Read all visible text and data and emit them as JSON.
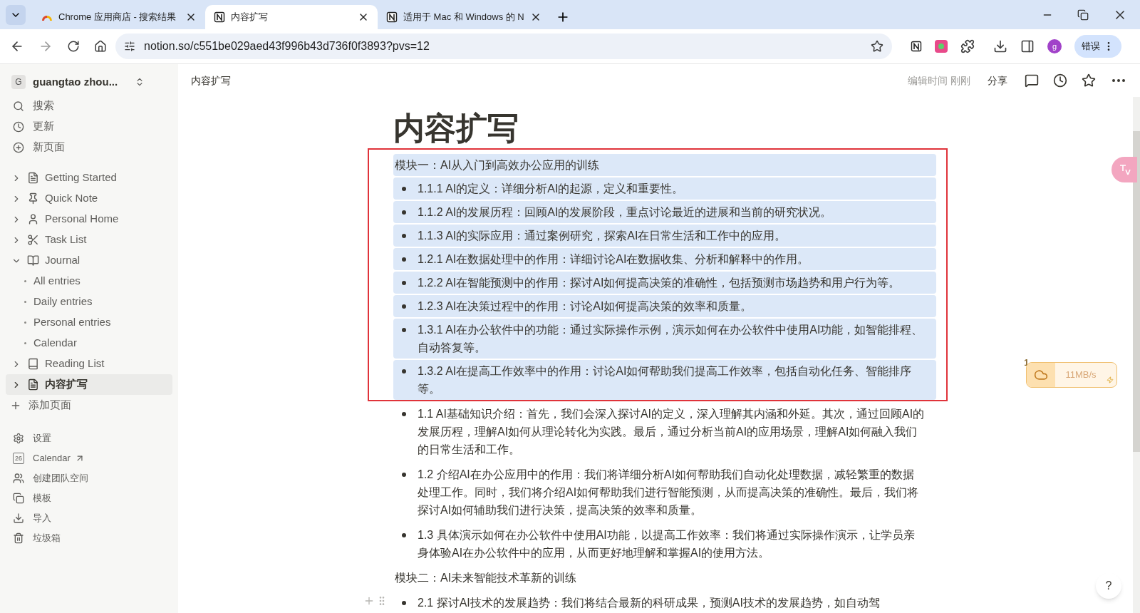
{
  "browser": {
    "tabs": [
      {
        "title": "Chrome 应用商店 - 搜索结果",
        "selected": false
      },
      {
        "title": "内容扩写",
        "selected": true
      },
      {
        "title": "适用于 Mac 和 Windows 的 N",
        "selected": false
      }
    ],
    "url": "notion.so/c551be029aed43f996b43d736f0f3893?pvs=12",
    "profile": "g",
    "error_button": "错误"
  },
  "sidebar": {
    "workspace_initial": "G",
    "workspace": "guangtao zhou...",
    "top_items": [
      {
        "label": "搜索"
      },
      {
        "label": "更新"
      },
      {
        "label": "新页面"
      }
    ],
    "pages": [
      {
        "label": "Getting Started",
        "expanded": false,
        "selected": false
      },
      {
        "label": "Quick Note",
        "expanded": false,
        "selected": false
      },
      {
        "label": "Personal Home",
        "expanded": false,
        "selected": false
      },
      {
        "label": "Task List",
        "expanded": false,
        "selected": false
      },
      {
        "label": "Journal",
        "expanded": true,
        "selected": false,
        "children": [
          {
            "label": "All entries"
          },
          {
            "label": "Daily entries"
          },
          {
            "label": "Personal entries"
          },
          {
            "label": "Calendar"
          }
        ]
      },
      {
        "label": "Reading List",
        "expanded": false,
        "selected": false
      },
      {
        "label": "内容扩写",
        "expanded": false,
        "selected": true
      }
    ],
    "add_page": "添加页面",
    "bottom_items": [
      {
        "label": "设置"
      },
      {
        "label": "Calendar",
        "calendar_day": "26"
      },
      {
        "label": "创建团队空间"
      },
      {
        "label": "模板"
      },
      {
        "label": "导入"
      },
      {
        "label": "垃圾箱"
      }
    ]
  },
  "topbar": {
    "breadcrumb": "内容扩写",
    "edited": "编辑时间 刚刚",
    "share": "分享"
  },
  "page": {
    "title": "内容扩写",
    "blocks": [
      {
        "kind": "text",
        "selected": true,
        "text": "模块一：AI从入门到高效办公应用的训练"
      },
      {
        "kind": "bullet",
        "selected": true,
        "text": "1.1.1 AI的定义：详细分析AI的起源，定义和重要性。"
      },
      {
        "kind": "bullet",
        "selected": true,
        "text": "1.1.2 AI的发展历程：回顾AI的发展阶段，重点讨论最近的进展和当前的研究状况。"
      },
      {
        "kind": "bullet",
        "selected": true,
        "text": "1.1.3 AI的实际应用：通过案例研究，探索AI在日常生活和工作中的应用。"
      },
      {
        "kind": "bullet",
        "selected": true,
        "text": "1.2.1 AI在数据处理中的作用：详细讨论AI在数据收集、分析和解释中的作用。"
      },
      {
        "kind": "bullet",
        "selected": true,
        "text": "1.2.2 AI在智能预测中的作用：探讨AI如何提高决策的准确性，包括预测市场趋势和用户行为等。"
      },
      {
        "kind": "bullet",
        "selected": true,
        "text": "1.2.3 AI在决策过程中的作用：讨论AI如何提高决策的效率和质量。"
      },
      {
        "kind": "bullet",
        "selected": true,
        "text": "1.3.1 AI在办公软件中的功能：通过实际操作示例，演示如何在办公软件中使用AI功能，如智能排程、自动答复等。"
      },
      {
        "kind": "bullet",
        "selected": true,
        "text": "1.3.2 AI在提高工作效率中的作用：讨论AI如何帮助我们提高工作效率，包括自动化任务、智能排序等。"
      },
      {
        "kind": "bullet",
        "selected": false,
        "text": "1.1 AI基础知识介绍：首先，我们会深入探讨AI的定义，深入理解其内涵和外延。其次，通过回顾AI的发展历程，理解AI如何从理论转化为实践。最后，通过分析当前AI的应用场景，理解AI如何融入我们的日常生活和工作。"
      },
      {
        "kind": "bullet",
        "selected": false,
        "text": "1.2 介绍AI在办公应用中的作用：我们将详细分析AI如何帮助我们自动化处理数据，减轻繁重的数据处理工作。同时，我们将介绍AI如何帮助我们进行智能预测，从而提高决策的准确性。最后，我们将探讨AI如何辅助我们进行决策，提高决策的效率和质量。"
      },
      {
        "kind": "bullet",
        "selected": false,
        "text": "1.3 具体演示如何在办公软件中使用AI功能，以提高工作效率：我们将通过实际操作演示，让学员亲身体验AI在办公软件中的应用，从而更好地理解和掌握AI的使用方法。"
      },
      {
        "kind": "text",
        "selected": false,
        "text": "模块二：AI未来智能技术革新的训练"
      },
      {
        "kind": "bullet",
        "selected": false,
        "hovered": true,
        "text": "2.1 探讨AI技术的发展趋势：我们将结合最新的科研成果，预测AI技术的发展趋势，如自动驾"
      }
    ]
  },
  "speed_widget": {
    "badge": "1",
    "speed": "11MB/s"
  },
  "help": "?"
}
